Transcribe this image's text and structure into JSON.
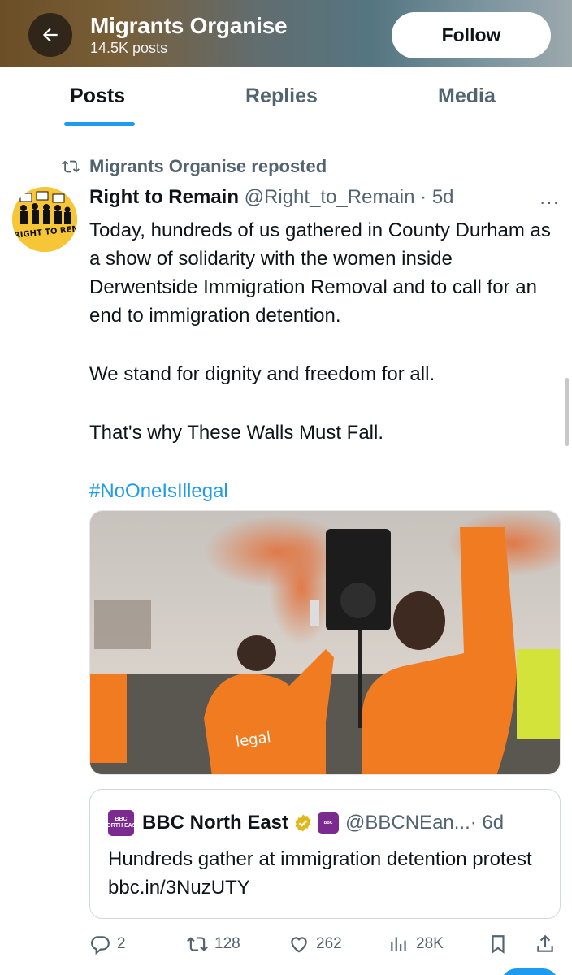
{
  "header": {
    "title": "Migrants Organise",
    "post_count": "14.5K posts",
    "follow_label": "Follow"
  },
  "tabs": [
    {
      "label": "Posts",
      "active": true
    },
    {
      "label": "Replies",
      "active": false
    },
    {
      "label": "Media",
      "active": false
    }
  ],
  "post": {
    "repost_label": "Migrants Organise reposted",
    "author_name": "Right to Remain",
    "author_handle": "@Right_to_Remain",
    "time": "· 5d",
    "more_label": "···",
    "avatar_text": "RIGHT TO REMAI",
    "paragraphs": [
      "Today, hundreds of us gathered in County Durham as a show of solidarity with the women inside Derwentside Immigration Removal and to call for an end to immigration detention.",
      "We stand for dignity and freedom for all.",
      "That's why These Walls Must Fall."
    ],
    "hashtag": "#NoOneIsIllegal",
    "quote": {
      "name": "BBC North East",
      "handle": "@BBCNEan...",
      "time": "· 6d",
      "text": "Hundreds gather at immigration detention protest bbc.in/3NuzUTY",
      "logo_text_1": "BBC",
      "logo_text_2": "NORTH EAST"
    },
    "actions": {
      "replies": "2",
      "reposts": "128",
      "likes": "262",
      "views": "28K"
    }
  },
  "colors": {
    "accent": "#1d9bf0",
    "muted": "#536471",
    "text": "#0f1419",
    "orange": "#ef7a1e"
  }
}
